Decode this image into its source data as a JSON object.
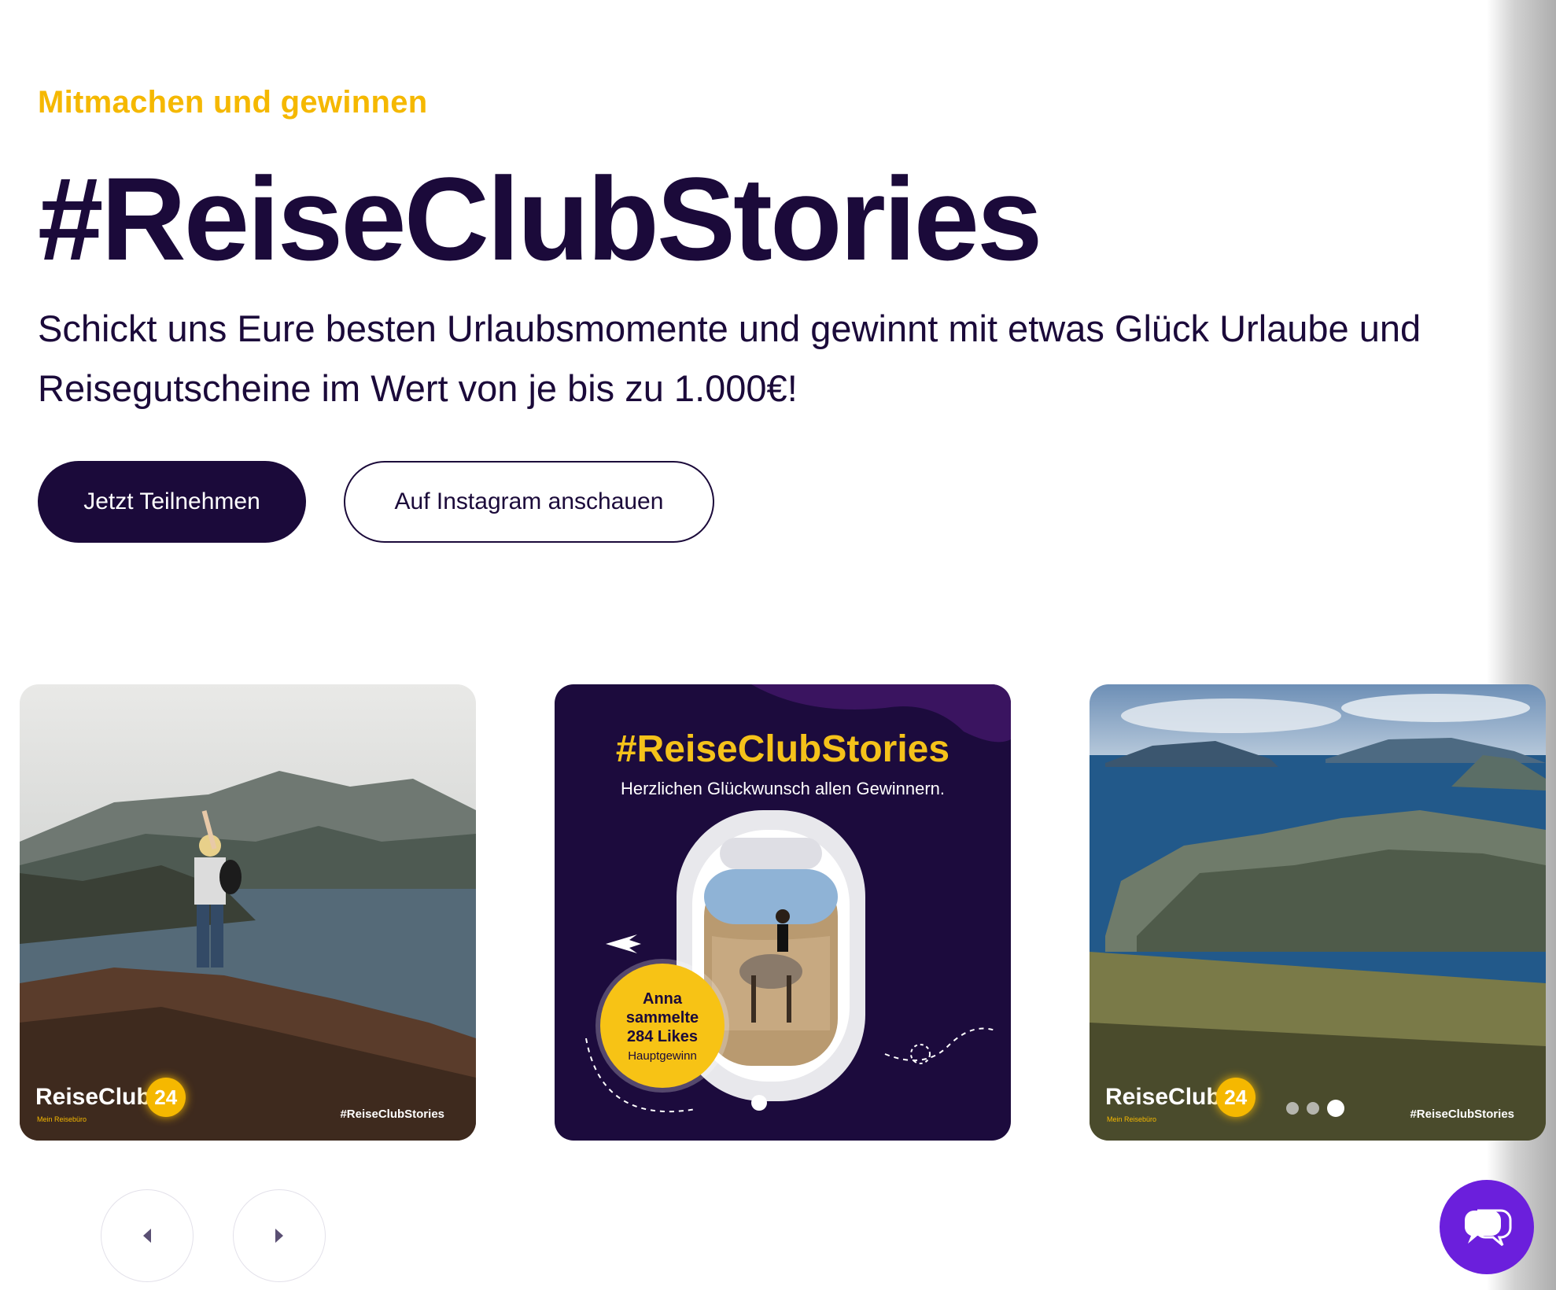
{
  "hero": {
    "eyebrow": "Mitmachen und gewinnen",
    "title": "#ReiseClubStories",
    "description": "Schickt uns Eure besten Urlaubsmomente und gewinnt mit etwas Glück Urlaube und Reisegutscheine im Wert von je bis zu 1.000€!",
    "primary_button": "Jetzt Teilnehmen",
    "secondary_button": "Auf Instagram anschauen"
  },
  "slides": [
    {
      "logo_text": "ReiseClub",
      "logo_badge": "24",
      "logo_sub": "Mein Reisebüro",
      "hashtag": "#ReiseClubStories"
    },
    {
      "title": "#ReiseClubStories",
      "subtitle": "Herzlichen Glückwunsch allen Gewinnern.",
      "winner_name": "Anna",
      "winner_line1": "sammelte",
      "winner_line2": "284 Likes",
      "winner_label": "Hauptgewinn"
    },
    {
      "logo_text": "ReiseClub",
      "logo_badge": "24",
      "logo_sub": "Mein Reisebüro",
      "hashtag": "#ReiseClubStories"
    }
  ],
  "carousel": {
    "prev_icon": "chevron-left-icon",
    "next_icon": "chevron-right-icon"
  },
  "chat": {
    "icon": "chat-bubbles-icon"
  },
  "colors": {
    "brand_dark": "#1b0a3a",
    "accent_yellow": "#f5b800",
    "chat_purple": "#6b1fdc"
  }
}
